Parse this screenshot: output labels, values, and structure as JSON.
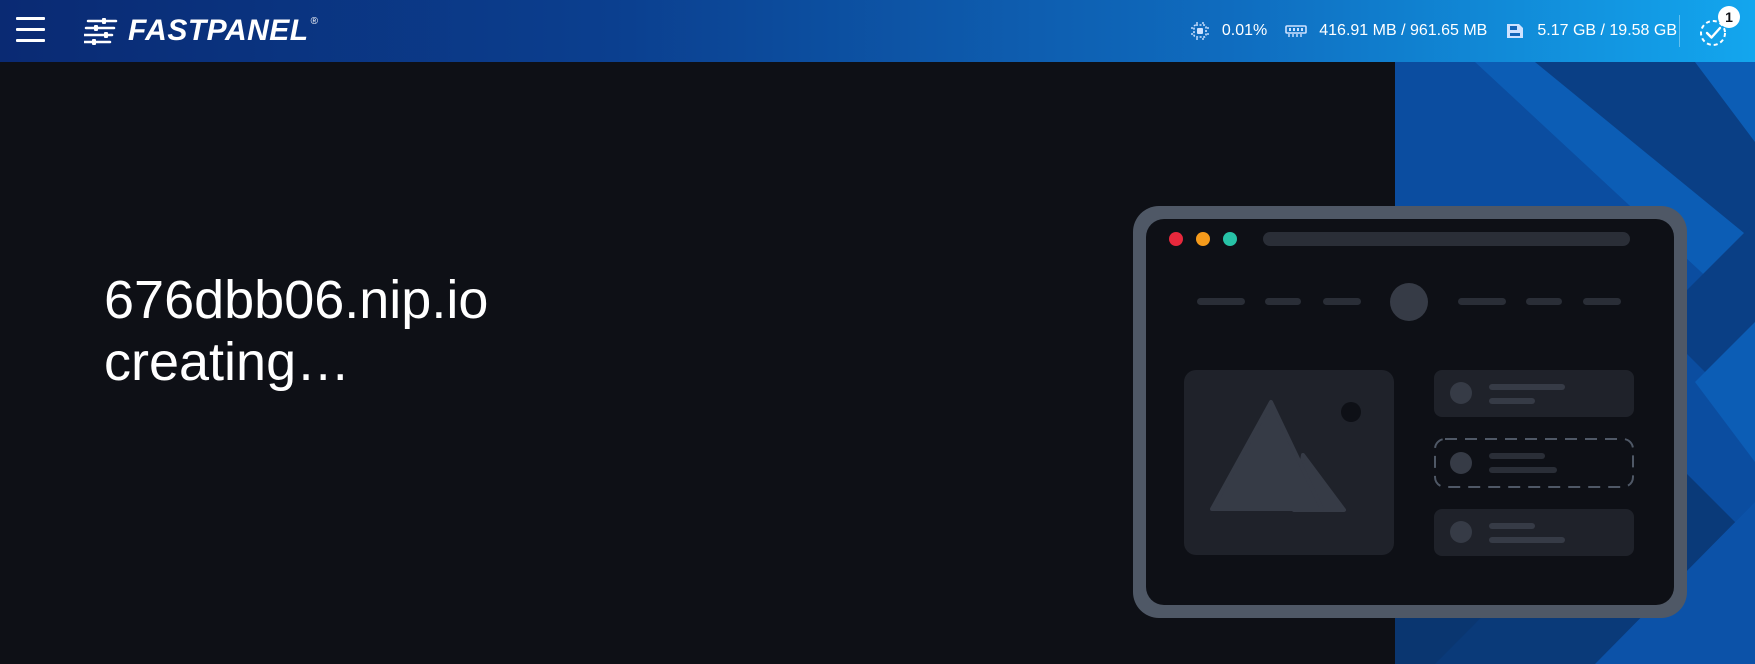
{
  "header": {
    "logo_text": "FASTPANEL",
    "logo_reg": "®",
    "stats": {
      "cpu": {
        "icon": "cpu-icon",
        "value": "0.01%"
      },
      "memory": {
        "icon": "memory-icon",
        "value": "416.91 MB / 961.65 MB"
      },
      "disk": {
        "icon": "disk-icon",
        "value": "5.17 GB / 19.58 GB"
      }
    },
    "tasks_badge": "1"
  },
  "main": {
    "domain": "676dbb06.nip.io",
    "status": "creating…"
  },
  "colors": {
    "topbar_start": "#0a2a73",
    "topbar_end": "#13a6ee",
    "background": "#0e1016",
    "accent_blue": "#0b4da0",
    "dot_red": "#e8283c",
    "dot_orange": "#f59a1b",
    "dot_teal": "#27c2a6"
  }
}
